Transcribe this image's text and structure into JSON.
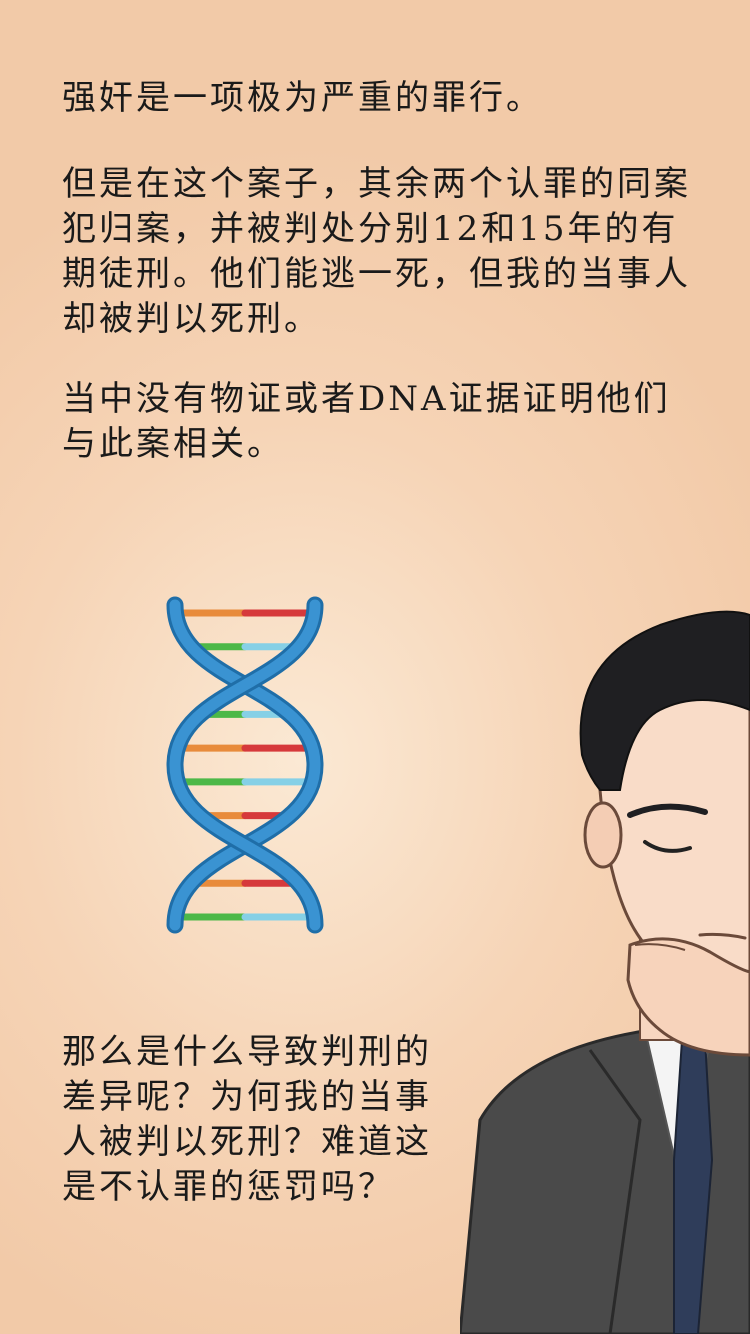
{
  "paragraphs": {
    "p1": "强奸是一项极为严重的罪行。",
    "p2": "但是在这个案子，其余两个认罪的同案犯归案，并被判处分别12和15年的有期徒刑。他们能逃一死，但我的当事人却被判以死刑。",
    "p3": "当中没有物证或者DNA证据证明他们与此案相关。",
    "p4": "那么是什么导致判刑的差异呢？为何我的当事人被判以死刑？难道这是不认罪的惩罚吗？"
  },
  "illustrations": {
    "dna_icon": "dna-double-helix-icon",
    "man_icon": "thinking-man-in-suit"
  },
  "colors": {
    "helix": "#2f86c6",
    "rung_orange": "#e88b3b",
    "rung_red": "#d6393b",
    "rung_green": "#4db848",
    "rung_cyan": "#86d0e6"
  }
}
